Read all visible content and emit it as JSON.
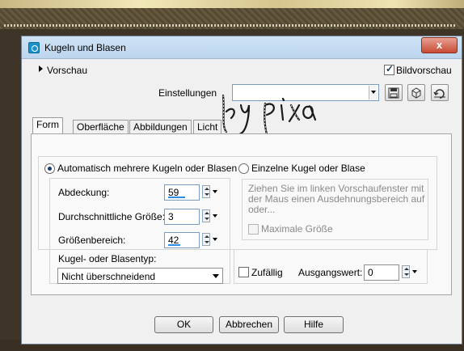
{
  "window": {
    "title": "Kugeln und Blasen",
    "close_glyph": "x"
  },
  "top": {
    "preview_toggle": "Vorschau",
    "bildvorschau_label": "Bildvorschau",
    "bildvorschau_checked": true,
    "settings_label": "Einstellungen",
    "settings_value": ""
  },
  "tabs": [
    {
      "label": "Form",
      "active": true
    },
    {
      "label": "Oberfläche",
      "active": false
    },
    {
      "label": "Abbildungen",
      "active": false
    },
    {
      "label": "Licht",
      "active": false
    }
  ],
  "mode": {
    "auto_label": "Automatisch mehrere Kugeln oder Blasen",
    "single_label": "Einzelne Kugel oder Blase",
    "selected": "auto"
  },
  "fields": {
    "abdeckung_label": "Abdeckung:",
    "abdeckung_value": "59",
    "abdeckung_fraction": 0.59,
    "groesse_label": "Durchschnittliche Größe:",
    "groesse_value": "3",
    "bereich_label": "Größenbereich:",
    "bereich_value": "42",
    "bereich_fraction": 0.42,
    "typ_label": "Kugel- oder Blasentyp:",
    "typ_value": "Nicht überschneidend"
  },
  "single": {
    "hint": "Ziehen Sie im linken Vorschaufenster mit der Maus einen Ausdehnungsbereich auf oder...",
    "max_label": "Maximale Größe"
  },
  "random": {
    "zufaellig_label": "Zufällig",
    "ausgang_label": "Ausgangswert:",
    "ausgang_value": "0"
  },
  "buttons": {
    "ok": "OK",
    "cancel": "Abbrechen",
    "help": "Hilfe"
  },
  "watermark": "by pixia",
  "colors": {
    "accent": "#2e8de0",
    "close": "#c74a33"
  }
}
